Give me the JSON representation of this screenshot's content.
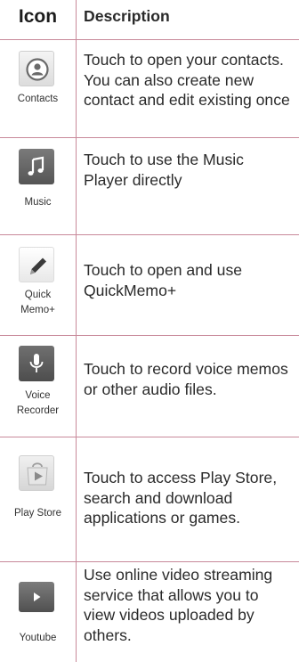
{
  "table": {
    "headers": {
      "icon": "Icon",
      "description": "Description"
    },
    "rows": [
      {
        "icon": "contacts-icon",
        "caption": [
          "Contacts"
        ],
        "description": [
          "Touch to open your contacts.",
          "You can also create new",
          "contact and edit existing once"
        ]
      },
      {
        "icon": "music-note-icon",
        "caption": [
          "Music"
        ],
        "description": [
          "Touch to use the Music",
          "Player directly"
        ]
      },
      {
        "icon": "pen-icon",
        "caption": [
          "Quick",
          "Memo+"
        ],
        "description": [
          "Touch to open and use",
          "QuickMemo+"
        ]
      },
      {
        "icon": "microphone-icon",
        "caption": [
          "Voice",
          "Recorder"
        ],
        "description": [
          "Touch to record voice memos",
          "or other audio files."
        ]
      },
      {
        "icon": "play-store-icon",
        "caption": [
          "Play Store"
        ],
        "description": [
          "Touch to access Play Store,",
          "search and download",
          "applications or games."
        ]
      },
      {
        "icon": "youtube-play-icon",
        "caption": [
          "Youtube"
        ],
        "description": [
          "Use online video streaming",
          "service that allows you to",
          "view videos uploaded by",
          "others."
        ]
      }
    ]
  },
  "colors": {
    "grid_lines": "#c8899a",
    "text": "#2a2a2a"
  }
}
